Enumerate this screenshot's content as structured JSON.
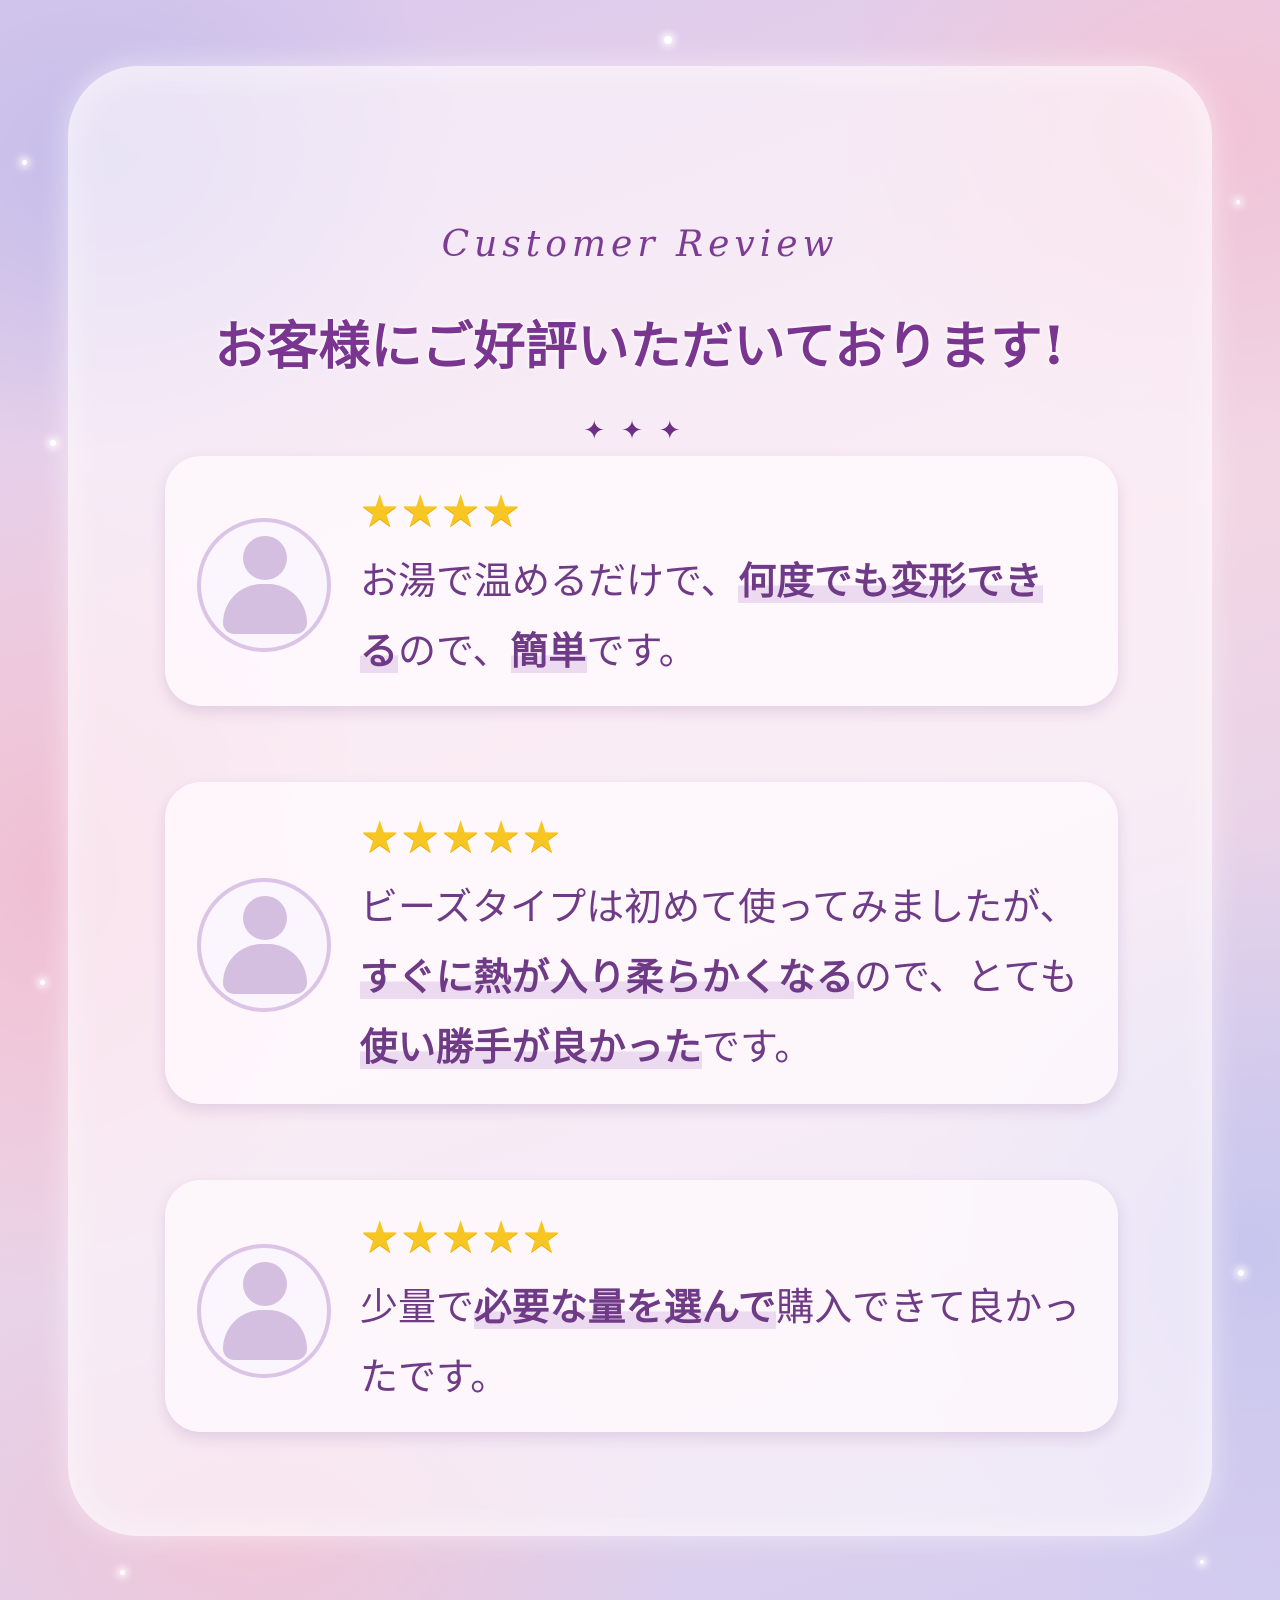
{
  "header": {
    "eyebrow": "Customer Review",
    "title": "お客様にご好評いただいております!",
    "divider": "✦✦✦"
  },
  "reviews": [
    {
      "stars": "★★★★",
      "rating": 4,
      "segments": [
        {
          "text": "お湯で温めるだけで、",
          "highlight": false
        },
        {
          "text": "何度でも変形でき",
          "highlight": true
        },
        {
          "text": "る",
          "highlight": true
        },
        {
          "text": "ので、",
          "highlight": false
        },
        {
          "text": "簡単",
          "highlight": true
        },
        {
          "text": "です。",
          "highlight": false
        }
      ]
    },
    {
      "stars": "★★★★★",
      "rating": 5,
      "segments": [
        {
          "text": "ビーズタイプは初めて使ってみましたが、",
          "highlight": false
        },
        {
          "text": "すぐに熱が入り柔らかくなる",
          "highlight": true
        },
        {
          "text": "ので、とても",
          "highlight": false
        },
        {
          "text": "使い勝手が良かった",
          "highlight": true
        },
        {
          "text": "です。",
          "highlight": false
        }
      ]
    },
    {
      "stars": "★★★★★",
      "rating": 5,
      "segments": [
        {
          "text": "少量で",
          "highlight": false
        },
        {
          "text": "必要な量を選んで",
          "highlight": true
        },
        {
          "text": "購入できて良かったです。",
          "highlight": false
        }
      ]
    }
  ],
  "colors": {
    "accent": "#7a3591",
    "star": "#f7c623",
    "highlight": "#ecdaf1",
    "avatar": "#d5bfe0"
  }
}
